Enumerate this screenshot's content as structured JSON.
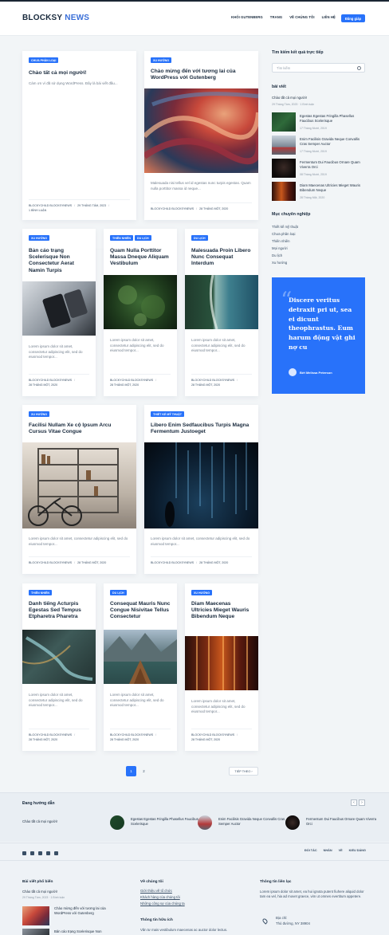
{
  "header": {
    "logo_a": "BLOCKSY",
    "logo_b": "NEWS",
    "menu": [
      "KHỐI GUTENBERG",
      "TRANG",
      "VỀ CHÚNG TÔI",
      "LIÊN HỆ"
    ],
    "signup": "Đăng giáp"
  },
  "posts": [
    {
      "tags": [
        "CHƯA PHÂN LOẠI"
      ],
      "title": "Chào tất cả mọi người!",
      "excerpt": "Cám ơn vì đã sử dụng WordPress. Đây là bài viết đầu...",
      "author": "BLOCKYCHILD BLOCKSYNEWS",
      "date": "29 THÁNG TÁM, 2023",
      "extra": "1 BÌNH LUẬN"
    },
    {
      "tags": [
        "XU HƯỚNG"
      ],
      "title": "Chào mừng đến với tương lai của WordPress với Gutenberg",
      "excerpt": "Malesuada nisi tellus vel id egestas nunc turpis egestas. Quam nulla porttitor massa id neque...",
      "author": "BLOCKYCHILD BLOCKSYNEWS",
      "date": "28 THÁNG MỘT, 2020"
    },
    {
      "tags": [
        "XU HƯỚNG"
      ],
      "title": "Bản cáo trạng Scelerisque Non Consectetur Aerat Namin Turpis",
      "excerpt": "Lorem ipsum dolor sit amet, consectetur adipiscing elit, sed do eiusmod tempor...",
      "author": "BLOCKYCHILD BLOCKSYNEWS",
      "date": "28 THÁNG MỘT, 2020"
    },
    {
      "tags": [
        "THIÊN NHIÊN",
        "DU LỊCH"
      ],
      "title": "Quam Nulla Porttitor Massa Dneque Aliquam Vestibulum",
      "excerpt": "Lorem ipsum dolor sit amet, consectetur adipiscing elit, sed do eiusmod tempor...",
      "author": "BLOCKYCHILD BLOCKSYNEWS",
      "date": "28 THÁNG MỘT, 2020"
    },
    {
      "tags": [
        "DU LỊCH"
      ],
      "title": "Malesuada Proin Libero Nunc Consequat Interdum",
      "excerpt": "Lorem ipsum dolor sit amet, consectetur adipiscing elit, sed do eiusmod tempor...",
      "author": "BLOCKYCHILD BLOCKSYNEWS",
      "date": "28 THÁNG MỘT, 2020"
    },
    {
      "tags": [
        "XU HƯỚNG"
      ],
      "title": "Facilisi Nullam Xe cộ Ipsum Arcu Cursus Vitae Congue",
      "excerpt": "Lorem ipsum dolor sit amet, consectetur adipiscing elit, sed do eiusmod tempor...",
      "author": "BLOCKYCHILD BLOCKSYNEWS",
      "date": "28 THÁNG MỘT, 2020"
    },
    {
      "tags": [
        "THIẾT KẾ MỸ THUẬT"
      ],
      "title": "Libero Enim Sedfaucibus Turpis Magna Fermentum Justoeget",
      "excerpt": "Lorem ipsum dolor sit amet, consectetur adipiscing elit, sed do eiusmod tempor...",
      "author": "BLOCKYCHILD BLOCKSYNEWS",
      "date": "28 THÁNG MỘT, 2020"
    },
    {
      "tags": [
        "THIÊN NHIÊN"
      ],
      "title": "Danh tiếng Acturpis Egestas Sed Tempus Etpharetra Pharetra",
      "excerpt": "Lorem ipsum dolor sit amet, consectetur adipiscing elit, sed do eiusmod tempor...",
      "author": "BLOCKYCHILD BLOCKSYNEWS",
      "date": "28 THÁNG MỘT, 2020"
    },
    {
      "tags": [
        "DU LỊCH"
      ],
      "title": "Consequat Mauris Nunc Congue Nisivitae Tellus Consectetur",
      "excerpt": "Lorem ipsum dolor sit amet, consectetur adipiscing elit, sed do eiusmod tempor...",
      "author": "BLOCKYCHILD BLOCKSYNEWS",
      "date": "28 THÁNG MỘT, 2020"
    },
    {
      "tags": [
        "XU HƯỚNG"
      ],
      "title": "Diam Maecenas Ultricies Mieget Wauris Bibendum Neque",
      "excerpt": "Lorem ipsum dolor sit amet, consectetur adipiscing elit, sed do eiusmod tempor...",
      "author": "BLOCKYCHILD BLOCKSYNEWS",
      "date": "28 THÁNG MỘT, 2020"
    }
  ],
  "sidebar": {
    "search_heading": "Tìm kiếm kết quả trực tiếp",
    "search_placeholder": "Tìm kiếm",
    "posts_heading": "bài viết",
    "first_post": "Chào tất cả mọi người!",
    "first_date": "29 Tháng Tám, 2023 · 1 Bình luận",
    "recent": [
      {
        "title": "Egestas Egestas Fringilla Phasellus Faucibus Scelerisque",
        "date": "17 Tháng Mười, 2019"
      },
      {
        "title": "Enim Facilisis Gravida Neque Convallis Cras Semper Auctor",
        "date": "17 Tháng Mười, 2019"
      },
      {
        "title": "Fermentum Dui Faucibus Ornare Quam Viverra Orci",
        "date": "08 Tháng Mười, 2019"
      },
      {
        "title": "Diam Maecenas Ultricies Mieget Wauris Bibendum Neque",
        "date": "28 Tháng Một, 2020"
      }
    ],
    "cats_heading": "Mục chuyên nghiệp",
    "cats": [
      "Thiết kế mỹ thuật",
      "Chưa phân loại",
      "Thiên nhiên",
      "Mọi người",
      "Du lịch",
      "Xu hướng"
    ],
    "quote": "Discere veritus detraxit pri ut, sea ei dicunt theophrastus. Eum harum động vật ghi nợ cu",
    "quote_by": "Bởi Melissa Peterson"
  },
  "pagination": {
    "pages": [
      "1",
      "2"
    ],
    "next": "TIẾP THEO ›"
  },
  "trending": {
    "heading": "Đang hướng dẫn",
    "first": "Chào tất cả mọi người!",
    "items": [
      "Egestas Egestas Fringilla Phasellus Faucibus Scelerisque",
      "Enim Facilisis Gravida Neque Convallis Cras Semper Auctor",
      "Fermentum Dui Faucibus Ornare Quam Viverra Orci"
    ],
    "prev": "‹",
    "next": "›"
  },
  "footer": {
    "nav": [
      "ĐỐI TÁC",
      "NHÂN",
      "VỀ",
      "KIỂU DÁNG"
    ],
    "col1_heading": "Bài viết phổ biến",
    "col1_first": "Chào tất cả mọi người!",
    "col1_first_date": "29 Tháng Tám, 2023 · 1 Bình luận",
    "col1_post1": "Chào mừng đến với tương lai của WordPress với Gutenberg",
    "col1_post2": "Bản cáo trạng Scelerisque Non",
    "col2_heading": "Về chúng tôi",
    "col2_links": [
      "Giới thiệu về tổ chức",
      "Khách hàng của chúng tôi",
      "Những công sự của chúng ta"
    ],
    "col2_heading2": "Thông tin hữu ích",
    "col2_text": "Văn tư mais vestibulum maecenas ac auctor dolor lectus.",
    "col3_heading": "Thông tin liên lạc",
    "col3_text": "Lorem ipsum dolor sit amet, ea hui ignota putent fiuhere aliquid dolor tam ea vel, hia ad movet graece, vim ut omnes evertitum appetere.",
    "col3_addr_label": "Địa chỉ:",
    "col3_addr": "Thủ đường, NY 38904"
  }
}
